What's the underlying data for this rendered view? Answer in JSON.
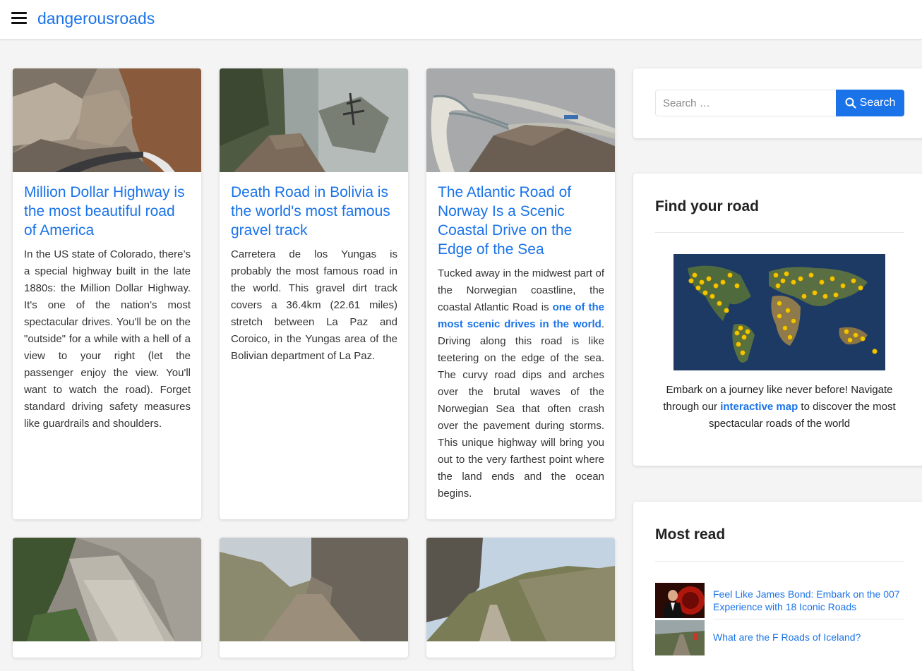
{
  "header": {
    "site_title": "dangerousroads",
    "menu_icon": "hamburger-menu-icon"
  },
  "articles": [
    {
      "title": "Million Dollar Highway is the most beautiful road of America",
      "excerpt": "In the US state of Colorado, there’s a special highway built in the late 1880s: the Million Dollar Highway. It's one of the nation’s most spectacular drives. You'll be on the \"outside\" for a while with a hell of a view to your right (let the passenger enjoy the view. You'll want to watch the road). Forget standard driving safety measures like guardrails and shoulders."
    },
    {
      "title": "Death Road in Bolivia is the world's most famous gravel track",
      "excerpt": "Carretera de los Yungas is probably the most famous road in the world. This gravel dirt track covers a 36.4km (22.61 miles) stretch between La Paz and Coroico, in the Yungas area of the Bolivian department of La Paz."
    },
    {
      "title": "The Atlantic Road of Norway Is a Scenic Coastal Drive on the Edge of the Sea",
      "excerpt_before": "Tucked away in the midwest part of the Norwegian coastline, the coastal Atlantic Road is ",
      "excerpt_link": "one of the most scenic drives in the world",
      "excerpt_after": ". Driving along this road is like teetering on the edge of the sea. The curvy road dips and arches over the brutal waves of the Norwegian Sea that often crash over the pavement during storms. This unique highway will bring you out to the very farthest point where the land ends and the ocean begins."
    }
  ],
  "search": {
    "placeholder": "Search …",
    "button_label": "Search"
  },
  "find_road": {
    "heading": "Find your road",
    "text_before": "Embark on a journey like never before! Navigate through our ",
    "link_text": "interactive map",
    "text_after": " to discover the most spectacular roads of the world"
  },
  "most_read": {
    "heading": "Most read",
    "items": [
      {
        "title": "Feel Like James Bond: Embark on the 007 Experience with 18 Iconic Roads"
      },
      {
        "title": "What are the F Roads of Iceland?"
      }
    ]
  },
  "colors": {
    "accent": "#1a73e8",
    "background": "#f4f4f4"
  }
}
